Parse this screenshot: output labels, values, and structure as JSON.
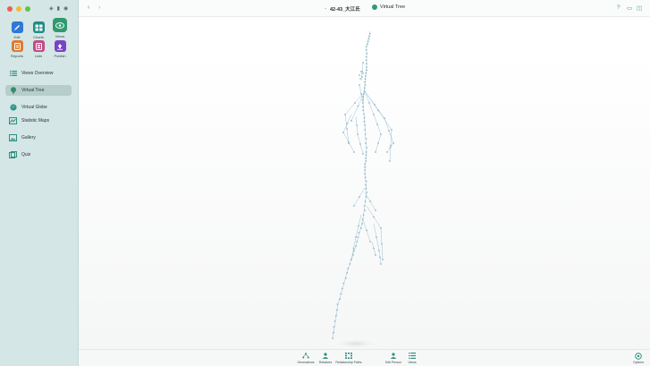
{
  "window": {
    "title": "42-43_大江氏",
    "subtitle": "Virtual Tree"
  },
  "modules": [
    {
      "label": "Edit",
      "icon": "edit-icon",
      "color": "#2f78d6"
    },
    {
      "label": "Charts",
      "icon": "charts-icon",
      "color": "#1f8b86"
    },
    {
      "label": "Views",
      "icon": "views-icon",
      "color": "#2f9a6e"
    },
    {
      "label": "Reports",
      "icon": "reports-icon",
      "color": "#e07a2e"
    },
    {
      "label": "Lists",
      "icon": "lists-icon",
      "color": "#c24b86"
    },
    {
      "label": "Publish",
      "icon": "publish-icon",
      "color": "#7a43c6"
    }
  ],
  "nav": [
    {
      "label": "Views Overview",
      "icon": "grid-list-icon"
    },
    {
      "label": "Virtual Tree",
      "icon": "tree-icon"
    },
    {
      "label": "Virtual Globe",
      "icon": "globe-icon"
    },
    {
      "label": "Statistic Maps",
      "icon": "map-icon"
    },
    {
      "label": "Gallery",
      "icon": "photo-icon"
    },
    {
      "label": "Quiz",
      "icon": "quiz-icon"
    }
  ],
  "bottom": [
    {
      "label": "Generations",
      "icon": "generations-icon"
    },
    {
      "label": "Relatives",
      "icon": "relatives-icon"
    },
    {
      "label": "Relationship Paths",
      "icon": "relationship-paths-icon"
    },
    {
      "label": "Edit Person",
      "icon": "edit-person-icon"
    },
    {
      "label": "Views",
      "icon": "views-icon"
    },
    {
      "label": "Options",
      "icon": "options-icon"
    }
  ],
  "colors": {
    "accent": "#2f9a6e",
    "sidebar": "#d4e6e5",
    "tree": "#8fb7c9"
  }
}
